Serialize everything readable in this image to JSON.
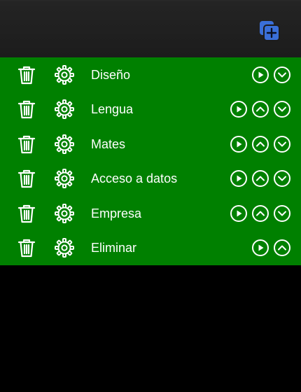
{
  "colors": {
    "list_background": "#008000",
    "header_background": "#1c1c1c",
    "page_background": "#000000",
    "add_button": "#3a6fd8",
    "foreground": "#ffffff"
  },
  "header": {
    "add_icon": "add-copy-icon"
  },
  "rows": [
    {
      "label": "Diseño",
      "controls": [
        "play",
        "down"
      ]
    },
    {
      "label": "Lengua",
      "controls": [
        "play",
        "up",
        "down"
      ]
    },
    {
      "label": "Mates",
      "controls": [
        "play",
        "up",
        "down"
      ]
    },
    {
      "label": "Acceso a datos",
      "controls": [
        "play",
        "up",
        "down"
      ]
    },
    {
      "label": "Empresa",
      "controls": [
        "play",
        "up",
        "down"
      ]
    },
    {
      "label": "Eliminar",
      "controls": [
        "play",
        "up"
      ]
    }
  ]
}
